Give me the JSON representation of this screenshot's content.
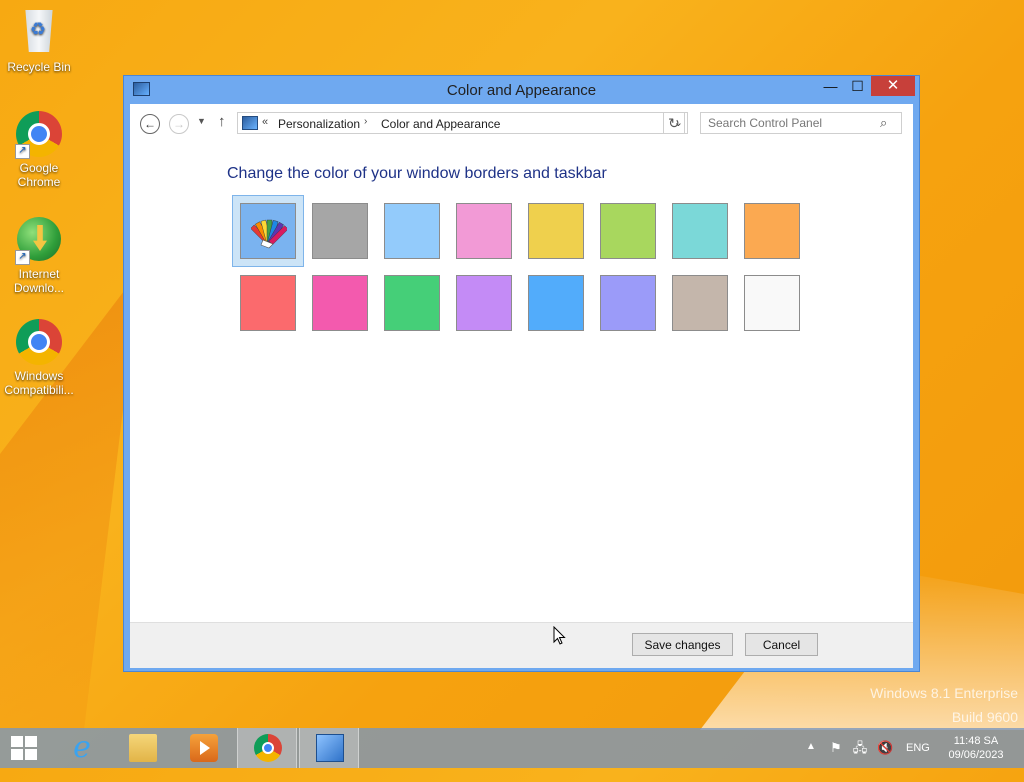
{
  "desktop": {
    "icons": [
      {
        "label": "Recycle Bin"
      },
      {
        "label": "Google Chrome"
      },
      {
        "label": "Internet Downlo..."
      },
      {
        "label": "Windows Compatibili..."
      }
    ],
    "watermark": {
      "line1": "Windows 8.1 Enterprise",
      "line2": "Build 9600"
    }
  },
  "window": {
    "title": "Color and Appearance",
    "controls": {
      "minimize": "—",
      "maximize": "☐",
      "close": "✕"
    },
    "address": {
      "back_glyph": "←",
      "forward_glyph": "→",
      "recent_glyph": "▼",
      "up_glyph": "↑",
      "chevron": "«",
      "breadcrumbs": [
        "Personalization",
        "Color and Appearance"
      ],
      "separator": "›",
      "dropdown_glyph": "⌄",
      "refresh_glyph": "↻"
    },
    "search": {
      "placeholder": "Search Control Panel",
      "icon_glyph": "⌕"
    },
    "heading": "Change the color of your window borders and taskbar",
    "swatches": [
      {
        "name": "automatic",
        "color": "#7ab3f0",
        "selected": true
      },
      {
        "name": "gray",
        "color": "#a6a6a6"
      },
      {
        "name": "sky",
        "color": "#93cbfb"
      },
      {
        "name": "pink",
        "color": "#f29ad6"
      },
      {
        "name": "yellow",
        "color": "#efd04d"
      },
      {
        "name": "lime",
        "color": "#a8d75e"
      },
      {
        "name": "teal",
        "color": "#7bd8d8"
      },
      {
        "name": "orange",
        "color": "#fba951"
      },
      {
        "name": "red",
        "color": "#fb6a6d"
      },
      {
        "name": "magenta",
        "color": "#f35aae"
      },
      {
        "name": "green",
        "color": "#45cf78"
      },
      {
        "name": "violet",
        "color": "#c48bf6"
      },
      {
        "name": "blue",
        "color": "#52acfb"
      },
      {
        "name": "periwinkle",
        "color": "#9b9bf9"
      },
      {
        "name": "taupe",
        "color": "#c4b6ab"
      },
      {
        "name": "white",
        "color": "#f9f9f9"
      }
    ],
    "buttons": {
      "save": "Save changes",
      "cancel": "Cancel"
    }
  },
  "taskbar": {
    "items": [
      "start-icon",
      "internet-explorer-icon",
      "file-explorer-icon",
      "media-player-icon",
      "chrome-icon",
      "control-panel-icon"
    ],
    "tray": {
      "overflow_glyph": "▲",
      "action_center_glyph": "⚑",
      "network_glyph": "🖧",
      "volume_glyph": "🔇",
      "language": "ENG",
      "time": "11:48 SA",
      "date": "09/06/2023"
    }
  }
}
